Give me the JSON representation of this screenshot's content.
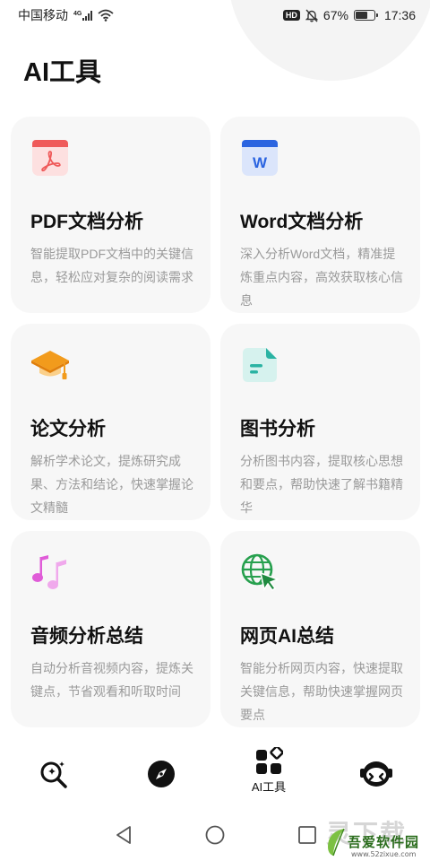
{
  "status_bar": {
    "carrier": "中国移动",
    "network_type": "4G",
    "hd_label": "HD",
    "battery": "67%",
    "battery_level": 0.67,
    "time": "17:36"
  },
  "page": {
    "title": "AI工具"
  },
  "tools": [
    {
      "title": "PDF文档分析",
      "description": "智能提取PDF文档中的关键信息，轻松应对复杂的阅读需求",
      "icon": "pdf-icon"
    },
    {
      "title": "Word文档分析",
      "description": "深入分析Word文档，精准提炼重点内容，高效获取核心信息",
      "icon": "word-doc-icon"
    },
    {
      "title": "论文分析",
      "description": "解析学术论文，提炼研究成果、方法和结论，快速掌握论文精髓",
      "icon": "graduation-cap-icon"
    },
    {
      "title": "图书分析",
      "description": "分析图书内容，提取核心思想和要点，帮助快速了解书籍精华",
      "icon": "book-document-icon"
    },
    {
      "title": "音频分析总结",
      "description": "自动分析音视频内容，提炼关键点，节省观看和听取时间",
      "icon": "music-notes-icon"
    },
    {
      "title": "网页AI总结",
      "description": "智能分析网页内容，快速提取关键信息，帮助快速掌握网页要点",
      "icon": "globe-cursor-icon"
    }
  ],
  "bottom_nav": {
    "items": [
      {
        "name": "search",
        "label": "",
        "icon": "sparkle-search-icon"
      },
      {
        "name": "discover",
        "label": "",
        "icon": "compass-icon"
      },
      {
        "name": "ai-tools",
        "label": "AI工具",
        "icon": "apps-grid-icon",
        "active": true
      },
      {
        "name": "assistant",
        "label": "",
        "icon": "robot-icon"
      }
    ]
  },
  "watermark": {
    "big": "灵下载",
    "main": "吾爱软件园",
    "url": "www.52zixue.com"
  },
  "colors": {
    "pdf": "#ef5a5a",
    "word": "#2b64e0",
    "cap": "#f29b1c",
    "book": "#2bb3a3",
    "music": "#e05cd8",
    "globe": "#27a04e",
    "card_bg": "#f7f7f7",
    "desc_text": "#9a9a9a"
  }
}
